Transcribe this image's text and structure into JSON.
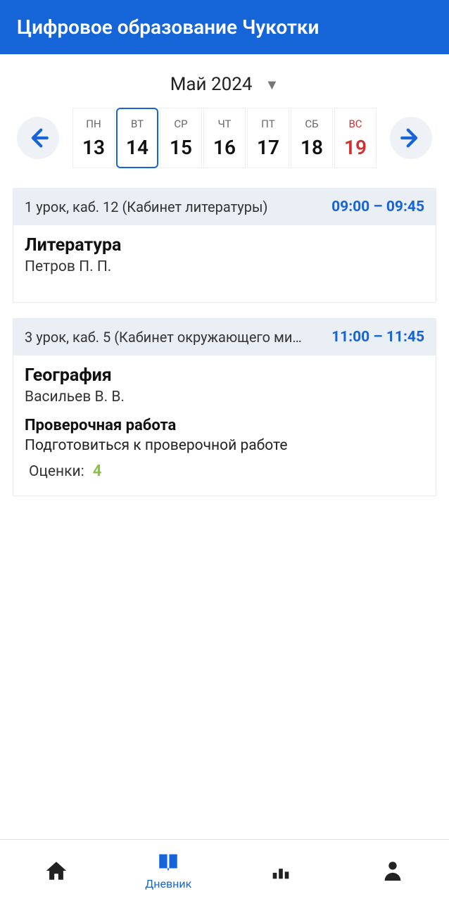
{
  "header": {
    "title": "Цифровое образование Чукотки"
  },
  "month": {
    "label": "Май 2024"
  },
  "days": [
    {
      "short": "ПН",
      "num": "13",
      "selected": false,
      "sunday": false
    },
    {
      "short": "ВТ",
      "num": "14",
      "selected": true,
      "sunday": false
    },
    {
      "short": "СР",
      "num": "15",
      "selected": false,
      "sunday": false
    },
    {
      "short": "ЧТ",
      "num": "16",
      "selected": false,
      "sunday": false
    },
    {
      "short": "ПТ",
      "num": "17",
      "selected": false,
      "sunday": false
    },
    {
      "short": "СБ",
      "num": "18",
      "selected": false,
      "sunday": false
    },
    {
      "short": "ВС",
      "num": "19",
      "selected": false,
      "sunday": true
    }
  ],
  "lessons": [
    {
      "meta": "1 урок, каб. 12 (Кабинет литературы)",
      "time": "09:00 – 09:45",
      "subject": "Литература",
      "teacher": "Петров П. П.",
      "hw_title": "",
      "hw_text": "",
      "grades_label": "",
      "grade": ""
    },
    {
      "meta": "3 урок, каб. 5 (Кабинет окружающего ми…",
      "time": "11:00 – 11:45",
      "subject": "География",
      "teacher": "Васильев В. В.",
      "hw_title": "Проверочная работа",
      "hw_text": "Подготовиться к проверочной работе",
      "grades_label": "Оценки:",
      "grade": "4"
    }
  ],
  "nav": {
    "diary_label": "Дневник"
  }
}
